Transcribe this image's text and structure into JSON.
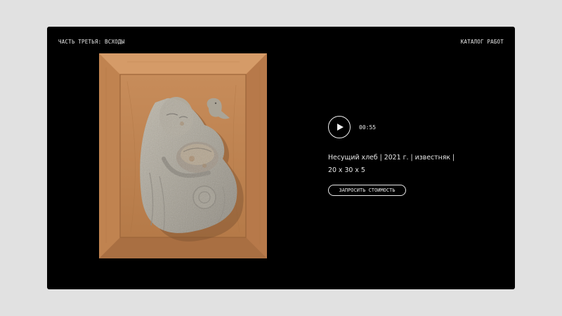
{
  "header": {
    "section_title": "ЧАСТЬ ТРЕТЬЯ: ВСХОДЫ",
    "catalog_link": "КАТАЛОГ РАБОТ"
  },
  "player": {
    "duration": "00:55",
    "play_icon": "play-icon"
  },
  "artwork": {
    "description_line1": "Несущий хлеб | 2021 г. | известняк |",
    "description_line2": "20 x 30 x 5",
    "image_semantic": "stone-relief-in-wooden-frame"
  },
  "actions": {
    "request_price_label": "ЗАПРОСИТЬ СТОИМОСТЬ"
  },
  "colors": {
    "page_background": "#e1e1e1",
    "card_background": "#000000",
    "text": "#e8e8e8",
    "frame_wood": "#c98d5a",
    "stone": "#a8a399"
  }
}
